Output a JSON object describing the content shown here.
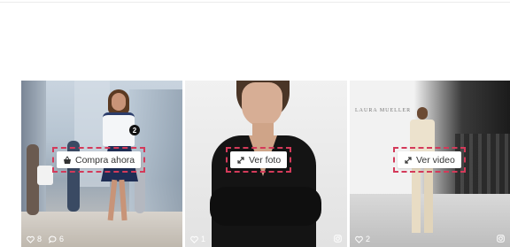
{
  "cards": [
    {
      "button_label": "Compra ahora",
      "button_icon": "basket-icon",
      "badge_count": "2",
      "likes": "8",
      "comments": "6",
      "source_icon": "instagram-icon"
    },
    {
      "button_label": "Ver foto",
      "button_icon": "expand-icon",
      "likes": "1",
      "source_icon": "instagram-icon"
    },
    {
      "button_label": "Ver video",
      "button_icon": "expand-icon",
      "likes": "2",
      "brand_text": "LAURA MUELLER",
      "source_icon": "instagram-icon"
    }
  ],
  "colors": {
    "highlight_dash": "#d43a5a",
    "button_bg": "#ffffff",
    "button_text": "#333333",
    "stats_text": "#ffffff"
  }
}
